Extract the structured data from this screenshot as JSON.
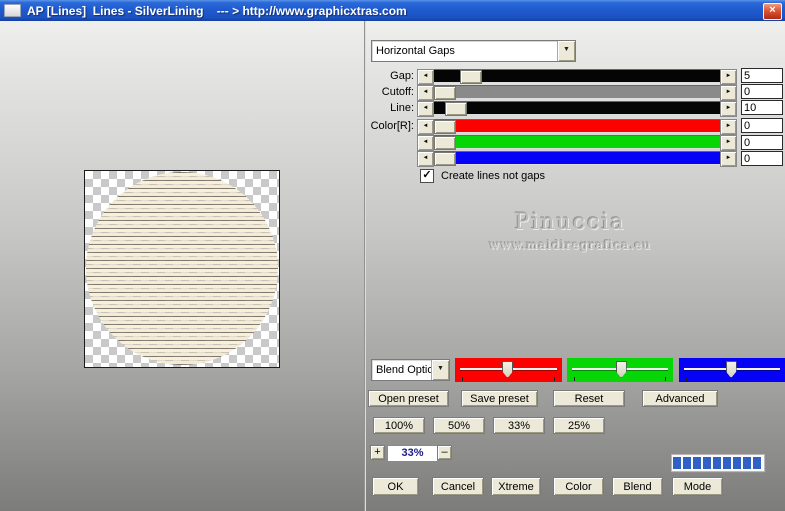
{
  "window": {
    "title": "AP [Lines]  Lines - SilverLining    --- > http://www.graphicxtras.com"
  },
  "glyphs": {
    "close": "×",
    "dropdown": "▼",
    "left_arrow": "◄",
    "right_arrow": "►",
    "check": "✓"
  },
  "preset_dropdown": {
    "value": "Horizontal Gaps"
  },
  "sliders": [
    {
      "label": "Gap:",
      "value": "5",
      "track_color": "#050505",
      "thumb_left": "9%"
    },
    {
      "label": "Cutoff:",
      "value": "0",
      "track_color": "#8a8a8a",
      "thumb_left": "0%"
    },
    {
      "label": "Line:",
      "value": "10",
      "track_color": "#050505",
      "thumb_left": "4%"
    },
    {
      "label": "Color[R]:",
      "value": "0",
      "track_color": "#fb0200",
      "thumb_left": "0%"
    },
    {
      "label": "",
      "value": "0",
      "track_color": "#06d506",
      "thumb_left": "0%"
    },
    {
      "label": "",
      "value": "0",
      "track_color": "#0502f5",
      "thumb_left": "0%"
    }
  ],
  "options": {
    "create_lines_label": "Create lines not gaps",
    "create_lines_checked": true
  },
  "watermark": {
    "name": "Pinuccia",
    "url": "www.maidiregrafica.eu"
  },
  "blend": {
    "dropdown_value": "Blend Options",
    "channels": [
      {
        "name": "red",
        "color": "#fb0200",
        "thumb_left": "44%"
      },
      {
        "name": "green",
        "color": "#06d506",
        "thumb_left": "46%"
      },
      {
        "name": "blue",
        "color": "#0502f5",
        "thumb_left": "44%"
      }
    ]
  },
  "preset_buttons": {
    "open": "Open preset",
    "save": "Save preset",
    "reset": "Reset",
    "advanced": "Advanced"
  },
  "zoom_presets": {
    "p100": "100%",
    "p50": "50%",
    "p33": "33%",
    "p25": "25%"
  },
  "zoom_control": {
    "plus": "+",
    "value": "33%",
    "minus": "–"
  },
  "progress": {
    "segments": 9,
    "color": "#2f62c4"
  },
  "action_buttons": {
    "ok": "OK",
    "cancel": "Cancel",
    "xtreme": "Xtreme",
    "color": "Color",
    "blend": "Blend",
    "mode": "Mode"
  }
}
